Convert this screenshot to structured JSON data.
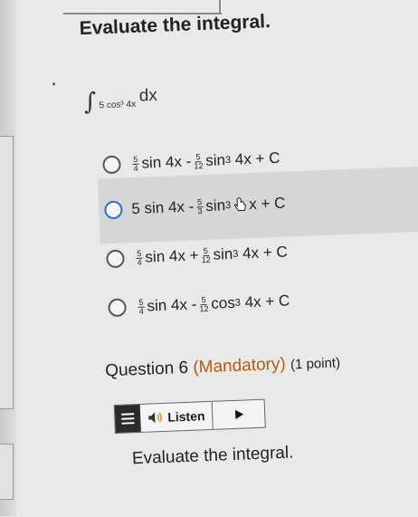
{
  "question": {
    "title": "Evaluate the integral.",
    "integrand": "5 cos³ 4x",
    "dx": "dx"
  },
  "options": [
    {
      "n1": "5",
      "d1": "4",
      "t1": "sin 4x -",
      "n2": "5",
      "d2": "12",
      "t2": "sin",
      "pow": "3",
      "t3": "4x + C",
      "selected": false
    },
    {
      "lead": "5 sin 4x -",
      "n2": "5",
      "d2": "3",
      "t2": "sin",
      "pow": "3",
      "t3": "x + C",
      "selected": false
    },
    {
      "n1": "5",
      "d1": "4",
      "t1": "sin 4x +",
      "n2": "5",
      "d2": "12",
      "t2": "sin",
      "pow": "3",
      "t3": "4x + C",
      "selected": false
    },
    {
      "n1": "5",
      "d1": "4",
      "t1": "sin 4x -",
      "n2": "5",
      "d2": "12",
      "t2": "cos",
      "pow": "3",
      "t3": "4x + C",
      "selected": false
    }
  ],
  "question6": {
    "label": "Question 6",
    "mandatory": "(Mandatory)",
    "points": "(1 point)",
    "listen_label": "Listen",
    "prompt": "Evaluate the integral."
  },
  "colors": {
    "accent": "#2d6ecc",
    "mandatory": "#b15a1b"
  }
}
